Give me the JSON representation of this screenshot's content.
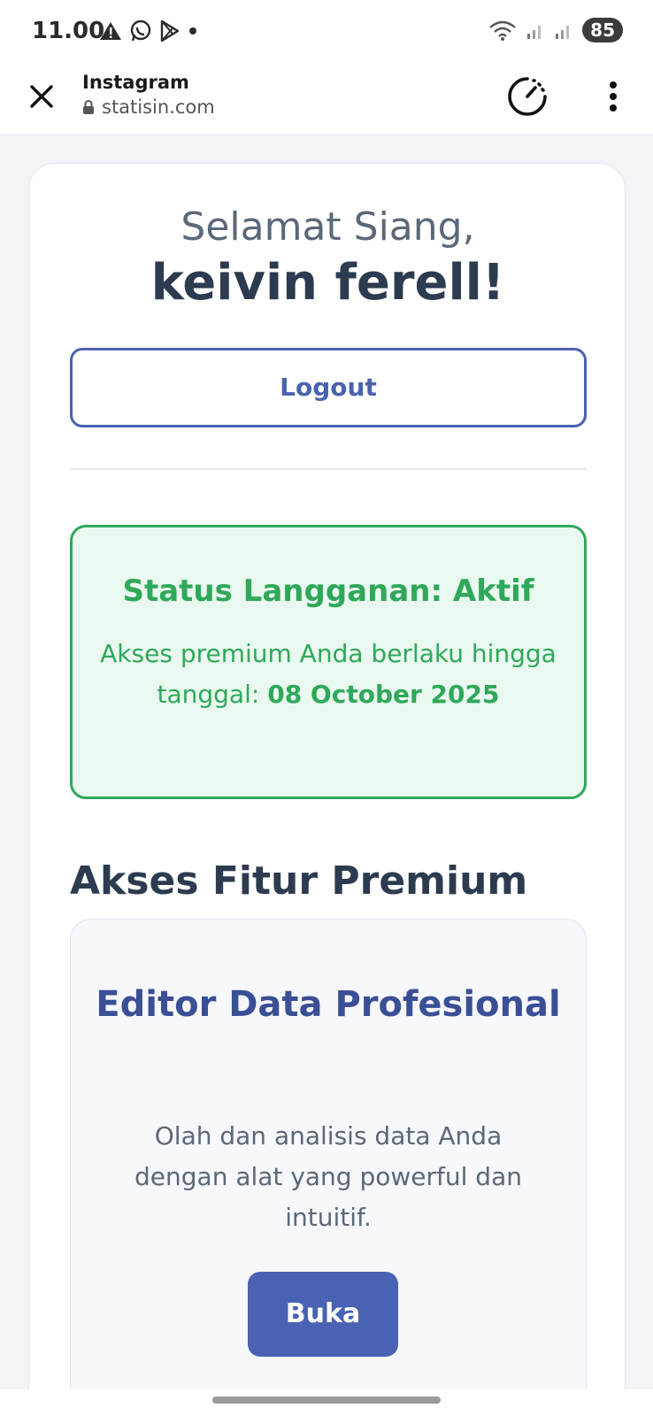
{
  "status_bar": {
    "time": "11.00",
    "battery": "85"
  },
  "browser": {
    "title": "Instagram",
    "url": "statisin.com"
  },
  "greeting": {
    "line1": "Selamat Siang,",
    "name": "keivin ferell!"
  },
  "logout_label": "Logout",
  "subscription": {
    "title": "Status Langganan: Aktif",
    "desc_prefix": "Akses premium Anda berlaku hingga tanggal:",
    "date": "08 October 2025",
    "color": "#2fa85a"
  },
  "premium_section": {
    "title": "Akses Fitur Premium",
    "feature": {
      "title": "Editor Data Profesional",
      "desc": "Olah dan analisis data Anda dengan alat yang powerful dan intuitif.",
      "button": "Buka"
    }
  },
  "colors": {
    "accent": "#4a62ae",
    "heading": "#2c3b4f"
  },
  "icons": {
    "status_left": [
      "warning-icon",
      "whatsapp-icon",
      "play-store-icon",
      "dot-icon"
    ],
    "status_right": [
      "wifi-icon",
      "signal-icon",
      "signal-icon",
      "battery-icon"
    ],
    "browser": [
      "close-icon",
      "lock-icon",
      "speed-icon",
      "more-vert-icon"
    ]
  }
}
